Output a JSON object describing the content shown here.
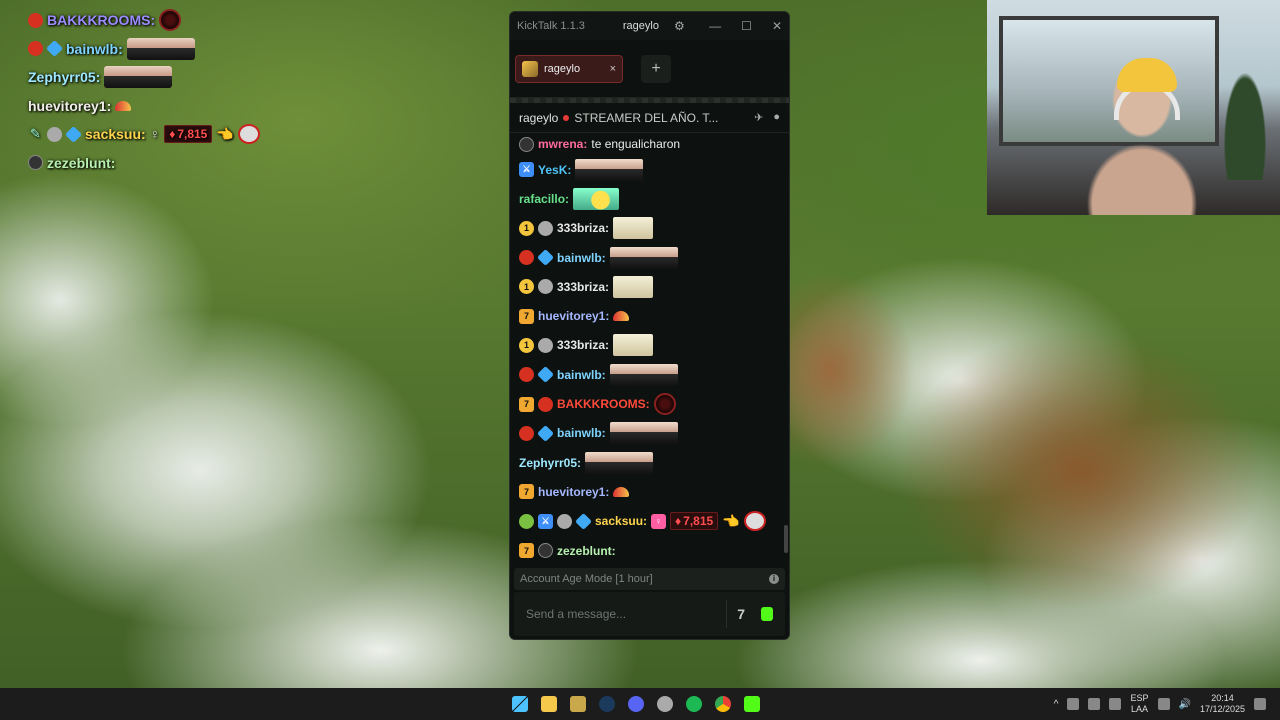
{
  "overlay_chat": [
    {
      "user": "BAKKKROOMS:",
      "color": "#9b8cff"
    },
    {
      "user": "bainwlb:",
      "color": "#7fd4ff"
    },
    {
      "user": "Zephyrr05:",
      "color": "#9ee8ff"
    },
    {
      "user": "huevitorey1:",
      "color": "#f0eee8"
    },
    {
      "user": "sacksuu:",
      "color": "#ffd54f",
      "sub_count": "7,815"
    },
    {
      "user": "zezeblunt:",
      "color": "#b8f0b0"
    }
  ],
  "kicktalk": {
    "app_name": "KickTalk 1.1.3",
    "username": "rageylo",
    "tab_label": "rageylo",
    "tab_close": "×",
    "add_tab": "+",
    "channel_name": "rageylo",
    "stream_title": "STREAMER DEL AÑO. T...",
    "messages": [
      {
        "user": "mwrena:",
        "color": "#ff6b9d",
        "text": "te engualicharon"
      },
      {
        "user": "YesK:",
        "color": "#4fc3f7"
      },
      {
        "user": "rafacillo:",
        "color": "#66e08a"
      },
      {
        "user": "333briza:",
        "color": "#e8e8e8"
      },
      {
        "user": "bainwlb:",
        "color": "#7fd4ff"
      },
      {
        "user": "333briza:",
        "color": "#e8e8e8"
      },
      {
        "user": "huevitorey1:",
        "color": "#a5b8ff"
      },
      {
        "user": "333briza:",
        "color": "#e8e8e8"
      },
      {
        "user": "bainwlb:",
        "color": "#7fd4ff"
      },
      {
        "user": "BAKKKROOMS:",
        "color": "#ff4a3a"
      },
      {
        "user": "bainwlb:",
        "color": "#7fd4ff"
      },
      {
        "user": "Zephyrr05:",
        "color": "#9ee8ff"
      },
      {
        "user": "huevitorey1:",
        "color": "#a5b8ff"
      },
      {
        "user": "sacksuu:",
        "color": "#ffd54f",
        "sub_count": "7,815"
      },
      {
        "user": "zezeblunt:",
        "color": "#b8f0b0"
      }
    ],
    "mode_label": "Account Age Mode [1 hour]",
    "message_placeholder": "Send a message..."
  },
  "taskbar": {
    "lang_top": "ESP",
    "lang_bottom": "LAA",
    "time": "20:14",
    "date": "17/12/2025"
  }
}
